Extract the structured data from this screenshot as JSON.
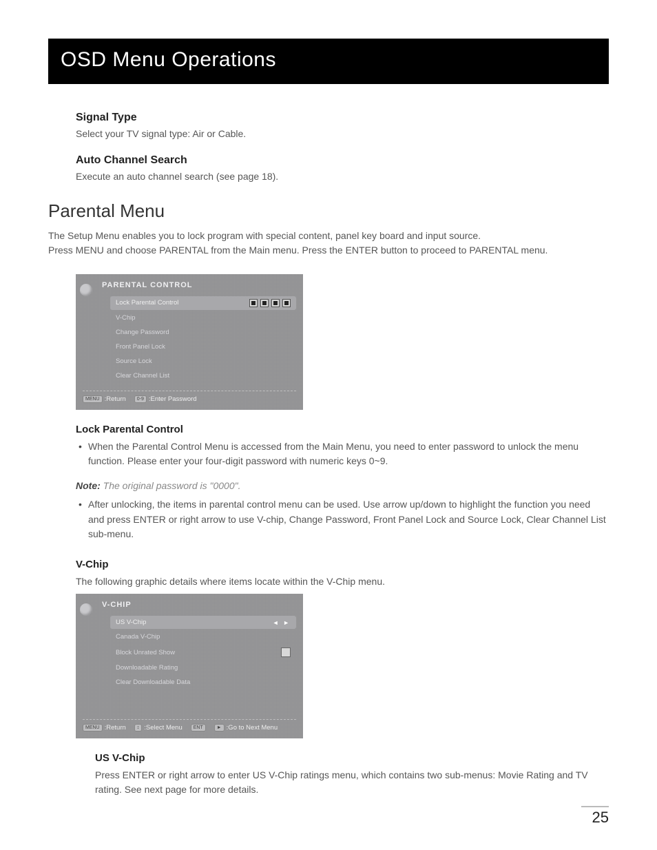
{
  "banner": {
    "title": "OSD Menu Operations"
  },
  "signal_type": {
    "heading": "Signal Type",
    "text": "Select your TV signal type: Air or Cable."
  },
  "auto_search": {
    "heading": "Auto Channel Search",
    "text": "Execute an auto channel search (see page 18)."
  },
  "parental_menu": {
    "heading": "Parental Menu",
    "intro": "The Setup Menu enables you to lock program with special content, panel key board and input source.\nPress MENU and choose PARENTAL from the Main menu. Press the ENTER button to proceed to PARENTAL menu."
  },
  "parental_osd": {
    "title": "PARENTAL CONTROL",
    "items": [
      {
        "label": "Lock Parental Control",
        "selected": true,
        "type": "password"
      },
      {
        "label": "V-Chip"
      },
      {
        "label": "Change Password"
      },
      {
        "label": "Front Panel Lock"
      },
      {
        "label": "Source Lock"
      },
      {
        "label": "Clear Channel List"
      }
    ],
    "footer": [
      {
        "key": "MENU",
        "label": "Return"
      },
      {
        "key": "0-9",
        "label": "Enter Password"
      }
    ]
  },
  "lock_section": {
    "heading": "Lock Parental Control",
    "bullets_top": [
      "When the Parental Control Menu is accessed from the Main Menu, you need to enter password to unlock the menu function. Please enter your four-digit password with numeric keys 0~9."
    ],
    "note_label": "Note:",
    "note_text": "The original password is \"0000\".",
    "bullets_bottom": [
      "After unlocking, the items in parental control menu can be used. Use arrow up/down to highlight the function you need and press ENTER or right arrow to use V-chip, Change Password, Front Panel Lock and Source Lock, Clear Channel List sub-menu."
    ]
  },
  "vchip_section": {
    "heading": "V-Chip",
    "intro": "The following graphic details where items locate within the V-Chip menu."
  },
  "vchip_osd": {
    "title": "V-CHIP",
    "items": [
      {
        "label": "US V-Chip",
        "selected": true,
        "type": "arrows"
      },
      {
        "label": "Canada V-Chip"
      },
      {
        "label": "Block Unrated Show",
        "type": "checkbox"
      },
      {
        "label": "Downloadable Rating"
      },
      {
        "label": "Clear Downloadable Data"
      }
    ],
    "footer": [
      {
        "key": "MENU",
        "label": "Return"
      },
      {
        "key": "↕",
        "label": "Select Menu"
      },
      {
        "key": "ENT",
        "label": ""
      },
      {
        "key": "►",
        "label": "Go to Next Menu"
      }
    ]
  },
  "us_vchip": {
    "heading": "US V-Chip",
    "text": "Press ENTER or right arrow to enter US V-Chip ratings menu, which contains two sub-menus: Movie Rating and TV rating. See next page for more details."
  },
  "page_number": "25"
}
